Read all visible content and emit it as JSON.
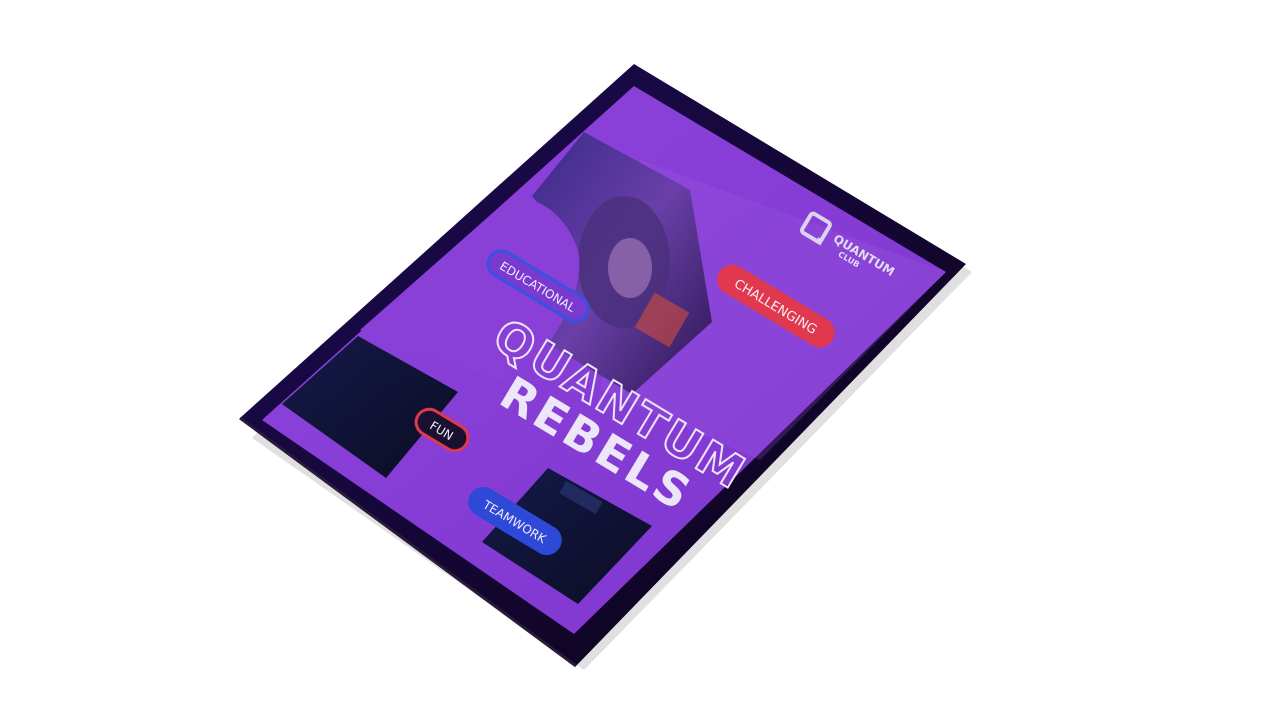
{
  "logo": {
    "line1": "QUANTUM",
    "line2": "CLUB"
  },
  "title": {
    "line1": "QUANTUM",
    "line2": "REBELS"
  },
  "tags": {
    "educational": "EDUCATIONAL",
    "challenging": "CHALLENGING",
    "fun": "FUN",
    "teamwork": "TEAMWORK"
  },
  "colors": {
    "frame": "#1a0a3a",
    "poster": "#8a3fd6",
    "poster_dark": "#6a2fb8",
    "tag_red": "#e0384f",
    "tag_blue": "#2e49d8",
    "text_light": "#eae4f7"
  }
}
